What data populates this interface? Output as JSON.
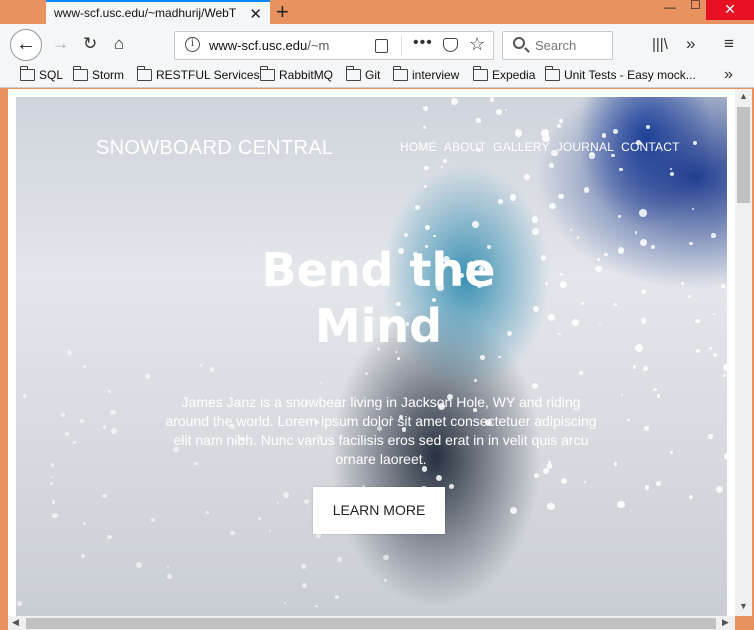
{
  "browser": {
    "tab_title": "www-scf.usc.edu/~madhurij/WebT",
    "url_host": "www-scf.usc.edu",
    "url_path": "/~m",
    "search_placeholder": "Search",
    "bookmarks": [
      "SQL",
      "Storm",
      "RESTFUL Services",
      "RabbitMQ",
      "Git",
      "interview",
      "Expedia",
      "Unit Tests - Easy mock..."
    ]
  },
  "site": {
    "brand": "SNOWBOARD CENTRAL",
    "nav": [
      "HOME",
      "ABOUT",
      "GALLERY",
      "JOURNAL",
      "CONTACT"
    ],
    "headline_line1": "Bend the",
    "headline_line2": "Mind",
    "intro": "James Janz is a snowbear living in Jackson Hole, WY and riding around the world. Lorem ipsum dolor sit amet consectetuer adipiscing elit nam nibh. Nunc varius facilisis eros sed erat in in velit quis arcu ornare laoreet.",
    "cta_label": "LEARN MORE"
  },
  "colors": {
    "chrome_frame": "#e8935f",
    "toolbar_bg": "#f5f6f7",
    "close_red": "#e81123",
    "accent_blue": "#0a84ff"
  }
}
